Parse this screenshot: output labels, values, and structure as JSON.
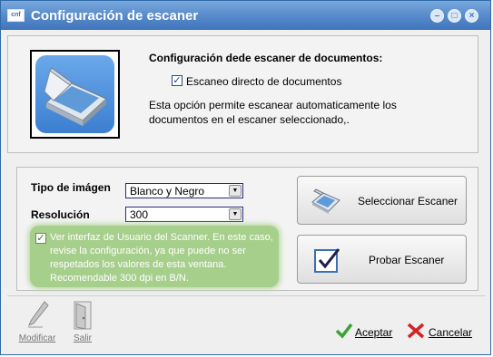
{
  "window": {
    "title": "Configuración de escaner",
    "app_icon_text": "cnf",
    "controls": {
      "minimize": "–",
      "maximize": "□",
      "close": "×"
    }
  },
  "top_section": {
    "heading": "Configuración dede escaner de documentos:",
    "direct_scan": {
      "label": "Escaneo directo de documentos",
      "checked": true
    },
    "description_line1": "Esta opción permite escanear automaticamente los",
    "description_line2": "documentos en el escaner seleccionado,."
  },
  "settings": {
    "image_type_label": "Tipo de imágen",
    "image_type_value": "Blanco y Negro",
    "resolution_label": "Resolución",
    "resolution_value": "300",
    "scanner_ui": {
      "checked": true,
      "text": "Ver interfaz de Usuario del Scanner. En este caso, revise la configuración, ya que puede no ser respetados los valores de esta ventana. Recomendable 300 dpi en B/N."
    }
  },
  "buttons": {
    "select_scanner": "Seleccionar Escaner",
    "test_scanner": "Probar Escaner"
  },
  "footer": {
    "modify_label": "Modificar",
    "exit_label": "Salir",
    "accept_label": "Aceptar",
    "cancel_label": "Cancelar"
  },
  "colors": {
    "title_bar": "#4a80c4",
    "note_bg": "#a7cf8c",
    "accept_icon": "#3aa534",
    "cancel_icon": "#d32424"
  },
  "icons": [
    "app-icon",
    "scanner-icon",
    "scanner-small-icon",
    "checkmark-icon",
    "pen-icon",
    "door-icon",
    "accept-icon",
    "cancel-icon"
  ]
}
